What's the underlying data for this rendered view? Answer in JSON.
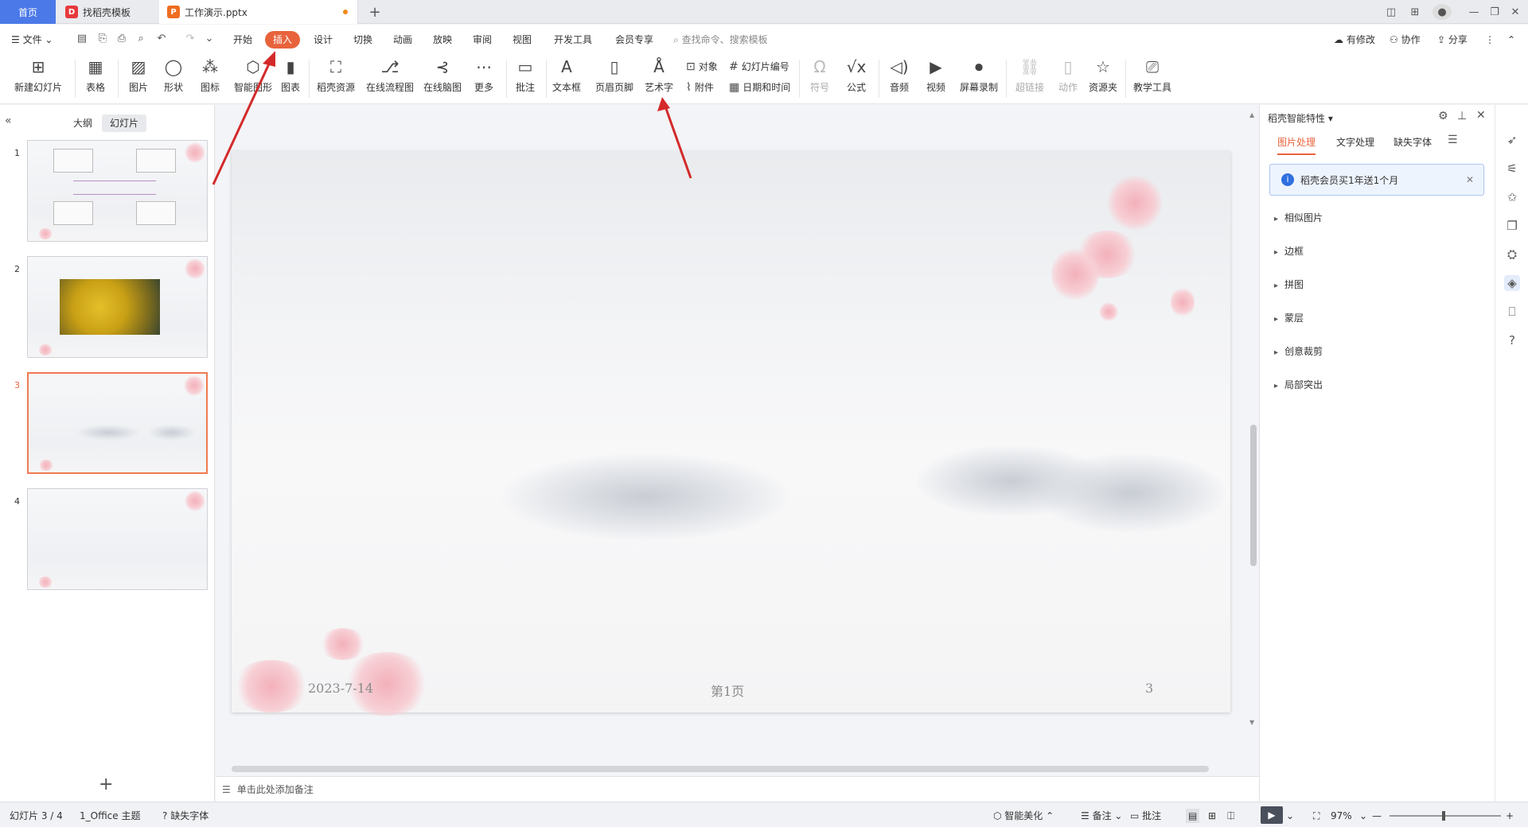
{
  "tabs": {
    "home": "首页",
    "template": "找稻壳模板",
    "document": "工作演示.pptx",
    "new_tab": "+"
  },
  "menu": {
    "file": "文件",
    "items": [
      "开始",
      "插入",
      "设计",
      "切换",
      "动画",
      "放映",
      "审阅",
      "视图",
      "开发工具",
      "会员专享"
    ],
    "active": "插入",
    "search_placeholder": "查找命令、搜索模板",
    "has_changes": "有修改",
    "collaborate": "协作",
    "share": "分享"
  },
  "ribbon": {
    "new_slide": "新建幻灯片",
    "table": "表格",
    "picture": "图片",
    "shape": "形状",
    "icon": "图标",
    "smart_graphic": "智能图形",
    "chart": "图表",
    "docer_resource": "稻壳资源",
    "online_flowchart": "在线流程图",
    "online_mindmap": "在线脑图",
    "more": "更多",
    "comment": "批注",
    "textbox": "文本框",
    "header_footer": "页眉页脚",
    "wordart": "艺术字",
    "object": "对象",
    "attachment": "附件",
    "slide_number": "幻灯片编号",
    "date_time": "日期和时间",
    "symbol": "符号",
    "formula": "公式",
    "audio": "音频",
    "video": "视频",
    "screen_record": "屏幕录制",
    "hyperlink": "超链接",
    "action": "动作",
    "resource_folder": "资源夹",
    "teaching_tools": "教学工具"
  },
  "left_panel": {
    "outline_tab": "大纲",
    "slides_tab": "幻灯片",
    "slide_numbers": [
      "1",
      "2",
      "3",
      "4"
    ],
    "selected": "3"
  },
  "slide": {
    "date": "2023-7-14",
    "page_label": "第1页",
    "number": "3"
  },
  "notes_placeholder": "单击此处添加备注",
  "right_panel": {
    "title": "稻壳智能特性",
    "tabs": [
      "图片处理",
      "文字处理",
      "缺失字体"
    ],
    "banner": "稻壳会员买1年送1个月",
    "items": [
      "相似图片",
      "边框",
      "拼图",
      "蒙层",
      "创意裁剪",
      "局部突出"
    ]
  },
  "status": {
    "slide_info": "幻灯片 3 / 4",
    "theme": "1_Office 主题",
    "missing_font": "缺失字体",
    "smart_beautify": "智能美化",
    "notes": "备注",
    "comments": "批注",
    "zoom": "97%"
  },
  "colors": {
    "accent": "#e8633b",
    "home_tab": "#4b79e8",
    "arrow": "#d42a2a"
  }
}
